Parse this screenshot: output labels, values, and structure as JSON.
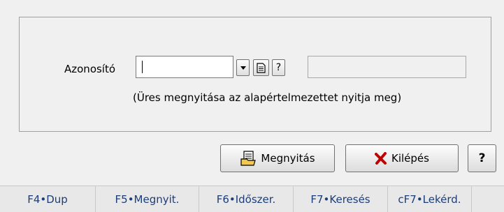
{
  "form": {
    "label": "Azonosító",
    "value": "",
    "description_value": "",
    "hint": "(Üres megnyitása az alapértelmezettet nyitja meg)",
    "help_small_label": "?"
  },
  "buttons": {
    "open_label": "Megnyitás",
    "exit_label": "Kilépés",
    "help_label": "?"
  },
  "statusbar": {
    "keys": [
      "F4•Dup",
      "F5•Megnyit.",
      "F6•Időszer.",
      "F7•Keresés",
      "cF7•Lekérd.",
      ""
    ]
  },
  "colors": {
    "exit_icon": "#c00000",
    "fkey_text": "#1c3d78"
  },
  "icons": [
    "dropdown-arrow-icon",
    "document-icon",
    "open-documents-icon",
    "close-x-icon"
  ]
}
